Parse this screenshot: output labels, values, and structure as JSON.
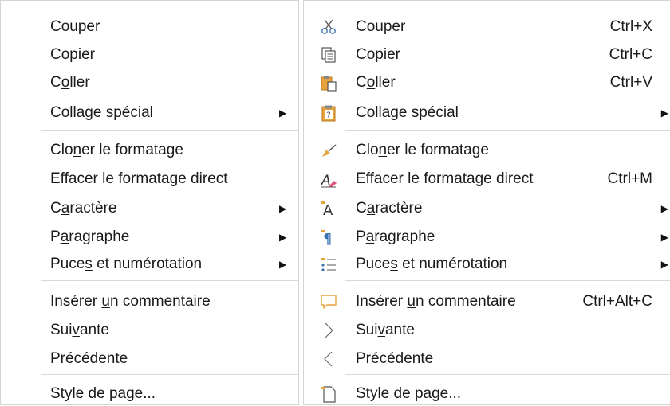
{
  "menus": [
    {
      "items": [
        {
          "before": "",
          "key": "C",
          "after": "ouper",
          "shortcut": "",
          "submenu": false
        },
        {
          "before": "Cop",
          "key": "i",
          "after": "er",
          "shortcut": "",
          "submenu": false
        },
        {
          "before": "C",
          "key": "o",
          "after": "ller",
          "shortcut": "",
          "submenu": false
        },
        {
          "before": "Collage ",
          "key": "s",
          "after": "pécial",
          "shortcut": "",
          "submenu": true
        },
        {
          "before": "Clo",
          "key": "n",
          "after": "er le formatage",
          "shortcut": "",
          "submenu": false
        },
        {
          "before": "Effacer le formatage ",
          "key": "d",
          "after": "irect",
          "shortcut": "",
          "submenu": false
        },
        {
          "before": "C",
          "key": "a",
          "after": "ractère",
          "shortcut": "",
          "submenu": true
        },
        {
          "before": "P",
          "key": "a",
          "after": "ragraphe",
          "shortcut": "",
          "submenu": true
        },
        {
          "before": "Puce",
          "key": "s",
          "after": " et numérotation",
          "shortcut": "",
          "submenu": true
        },
        {
          "before": "Insérer ",
          "key": "u",
          "after": "n commentaire",
          "shortcut": "",
          "submenu": false
        },
        {
          "before": "Sui",
          "key": "v",
          "after": "ante",
          "shortcut": "",
          "submenu": false
        },
        {
          "before": "Précéd",
          "key": "e",
          "after": "nte",
          "shortcut": "",
          "submenu": false
        },
        {
          "before": "Style de ",
          "key": "p",
          "after": "age...",
          "shortcut": "",
          "submenu": false
        }
      ]
    },
    {
      "items": [
        {
          "icon": "scissors-icon",
          "before": "",
          "key": "C",
          "after": "ouper",
          "shortcut": "Ctrl+X",
          "submenu": false
        },
        {
          "icon": "copy-icon",
          "before": "Cop",
          "key": "i",
          "after": "er",
          "shortcut": "Ctrl+C",
          "submenu": false
        },
        {
          "icon": "paste-icon",
          "before": "C",
          "key": "o",
          "after": "ller",
          "shortcut": "Ctrl+V",
          "submenu": false
        },
        {
          "icon": "paste-special-icon",
          "before": "Collage ",
          "key": "s",
          "after": "pécial",
          "shortcut": "",
          "submenu": true
        },
        {
          "icon": "clone-brush-icon",
          "before": "Clo",
          "key": "n",
          "after": "er le formatage",
          "shortcut": "",
          "submenu": false
        },
        {
          "icon": "clear-formatting-icon",
          "before": "Effacer le formatage ",
          "key": "d",
          "after": "irect",
          "shortcut": "Ctrl+M",
          "submenu": false
        },
        {
          "icon": "character-icon",
          "before": "C",
          "key": "a",
          "after": "ractère",
          "shortcut": "",
          "submenu": true
        },
        {
          "icon": "paragraph-icon",
          "before": "P",
          "key": "a",
          "after": "ragraphe",
          "shortcut": "",
          "submenu": true
        },
        {
          "icon": "bullets-numbering-icon",
          "before": "Puce",
          "key": "s",
          "after": " et numérotation",
          "shortcut": "",
          "submenu": true
        },
        {
          "icon": "comment-icon",
          "before": "Insérer ",
          "key": "u",
          "after": "n commentaire",
          "shortcut": "Ctrl+Alt+C",
          "submenu": false
        },
        {
          "icon": "next-icon",
          "before": "Sui",
          "key": "v",
          "after": "ante",
          "shortcut": "",
          "submenu": false
        },
        {
          "icon": "previous-icon",
          "before": "Précéd",
          "key": "e",
          "after": "nte",
          "shortcut": "",
          "submenu": false
        },
        {
          "icon": "page-style-icon",
          "before": "Style de ",
          "key": "p",
          "after": "age...",
          "shortcut": "",
          "submenu": false
        }
      ]
    }
  ],
  "submenu_arrow": "▶",
  "colors": {
    "accent_orange": "#e8a33d",
    "separator": "#d9d9d9",
    "text": "#1a1a1a"
  }
}
